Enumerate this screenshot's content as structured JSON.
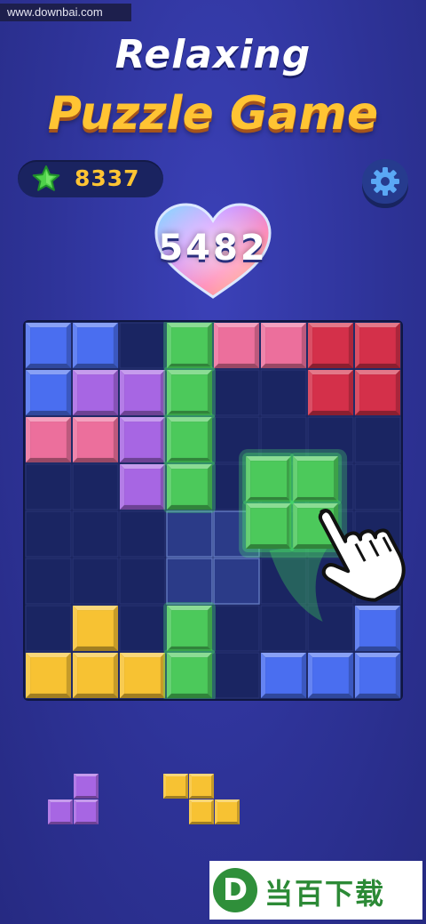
{
  "watermark_top": "www.downbai.com",
  "title": {
    "line1": "Relaxing",
    "line2": "Puzzle Game"
  },
  "coins": {
    "icon": "star-icon",
    "value": "8337"
  },
  "settings": {
    "icon": "gear-icon"
  },
  "score": "5482",
  "colors": {
    "blue": "#4a6ef0",
    "purple": "#a766e3",
    "pink": "#ec6f9c",
    "red": "#d4304a",
    "green": "#4cc95b",
    "yellow": "#f7c233",
    "board_bg": "#17215a",
    "cell_line": "#2a3577",
    "accent_gold": "#ffc433"
  },
  "board": {
    "size": 8,
    "rows": [
      [
        "blue",
        "blue",
        "",
        "green",
        "pink",
        "pink",
        "red",
        "red"
      ],
      [
        "blue",
        "purple",
        "purple",
        "green",
        "",
        "",
        "red",
        "red"
      ],
      [
        "pink",
        "pink",
        "purple",
        "green",
        "",
        "",
        "",
        ""
      ],
      [
        "",
        "",
        "purple",
        "green",
        "",
        "",
        "",
        ""
      ],
      [
        "",
        "",
        "",
        "",
        "",
        "",
        "",
        ""
      ],
      [
        "",
        "",
        "",
        "",
        "",
        "",
        "",
        ""
      ],
      [
        "",
        "yellow",
        "",
        "green",
        "",
        "",
        "",
        "blue"
      ],
      [
        "yellow",
        "yellow",
        "yellow",
        "green",
        "",
        "blue",
        "blue",
        "blue"
      ]
    ],
    "placement_preview": [
      [
        4,
        3
      ],
      [
        4,
        4
      ],
      [
        5,
        3
      ],
      [
        5,
        4
      ]
    ],
    "dragged_piece": {
      "color": "green",
      "cells": [
        [
          0,
          0
        ],
        [
          0,
          1
        ],
        [
          1,
          0
        ],
        [
          1,
          1
        ]
      ],
      "at_row": 2.85,
      "at_col": 4.7
    }
  },
  "tray": [
    {
      "name": "tray-piece-purple",
      "color": "purple",
      "cells": [
        [
          0,
          1
        ],
        [
          1,
          0
        ],
        [
          1,
          1
        ]
      ]
    },
    {
      "name": "tray-piece-yellow",
      "color": "yellow",
      "cells": [
        [
          0,
          0
        ],
        [
          0,
          1
        ],
        [
          1,
          1
        ],
        [
          1,
          2
        ]
      ]
    }
  ],
  "cursor": {
    "icon": "hand-pointer-icon"
  },
  "watermark_bottom": {
    "logo": "D",
    "text": "当百下载"
  }
}
